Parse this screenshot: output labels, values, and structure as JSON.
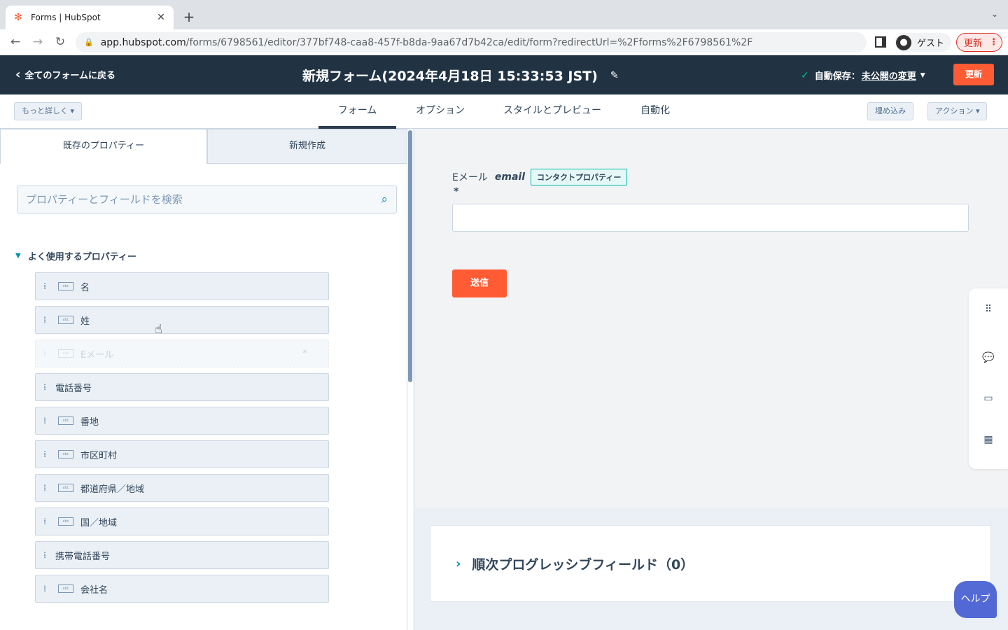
{
  "browser": {
    "tab_title": "Forms | HubSpot",
    "url_host": "app.hubspot.com",
    "url_path": "/forms/6798561/editor/377bf748-caa8-457f-b8da-9aa67d7b42ca/edit/form?redirectUrl=%2Fforms%2F6798561%2F",
    "profile_label": "ゲスト",
    "update_label": "更新"
  },
  "header": {
    "back_label": "全てのフォームに戻る",
    "form_title": "新規フォーム(2024年4月18日 15:33:53 JST)",
    "autosave_label": "自動保存：",
    "unpublished_link": "未公開の変更",
    "update_button": "更新"
  },
  "toolbar": {
    "more_details": "もっと詳しく",
    "tabs": [
      "フォーム",
      "オプション",
      "スタイルとプレビュー",
      "自動化"
    ],
    "embed": "埋め込み",
    "actions": "アクション"
  },
  "left_panel": {
    "tab_existing": "既存のプロパティー",
    "tab_new": "新規作成",
    "search_placeholder": "プロパティーとフィールドを検索",
    "group_title": "よく使用するプロパティー",
    "properties": [
      "名",
      "姓",
      "Eメール",
      "電話番号",
      "番地",
      "市区町村",
      "都道府県／地域",
      "国／地域",
      "携帯電話番号",
      "会社名"
    ],
    "required_mark": "*"
  },
  "preview": {
    "field_label": "Eメール",
    "field_internal": "email",
    "field_badge": "コンタクトプロパティー",
    "required_mark": "*",
    "submit_label": "送信",
    "progressive_title": "順次プログレッシブフィールド（0）",
    "help_label": "ヘルプ"
  }
}
